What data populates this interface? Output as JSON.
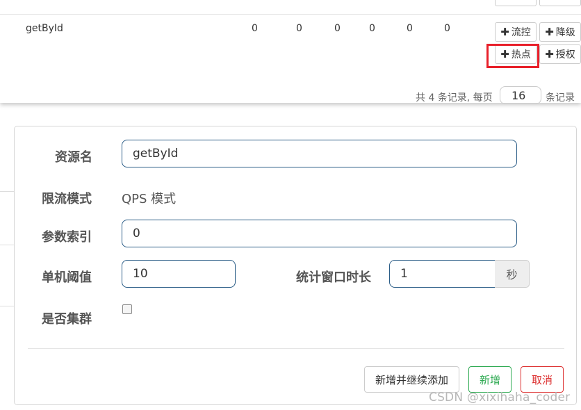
{
  "table": {
    "row": {
      "resource": "getById",
      "metrics": [
        "0",
        "0",
        "0",
        "0",
        "0",
        "0"
      ]
    },
    "ops": {
      "plus_glyph": "✚",
      "flow_label": "流控",
      "degrade_label": "降级",
      "hotspot_label": "热点",
      "auth_label": "授权"
    },
    "pager": {
      "summary": "共 4 条记录, 每页",
      "page_size": "16",
      "suffix": "条记录"
    }
  },
  "dialog": {
    "resource_label": "资源名",
    "resource_value": "getById",
    "mode_label": "限流模式",
    "mode_value": "QPS 模式",
    "param_index_label": "参数索引",
    "param_index_value": "0",
    "threshold_label": "单机阈值",
    "threshold_value": "10",
    "window_label": "统计窗口时长",
    "window_value": "1",
    "window_unit": "秒",
    "cluster_label": "是否集群",
    "cluster_checked": false,
    "buttons": {
      "add_continue": "新增并继续添加",
      "add": "新增",
      "cancel": "取消"
    }
  },
  "watermark": "CSDN @xixihaha_coder",
  "colors": {
    "input_border": "#2a5c86",
    "success": "#2eaa52",
    "danger": "#dd3333",
    "highlight": "#e8202a"
  }
}
